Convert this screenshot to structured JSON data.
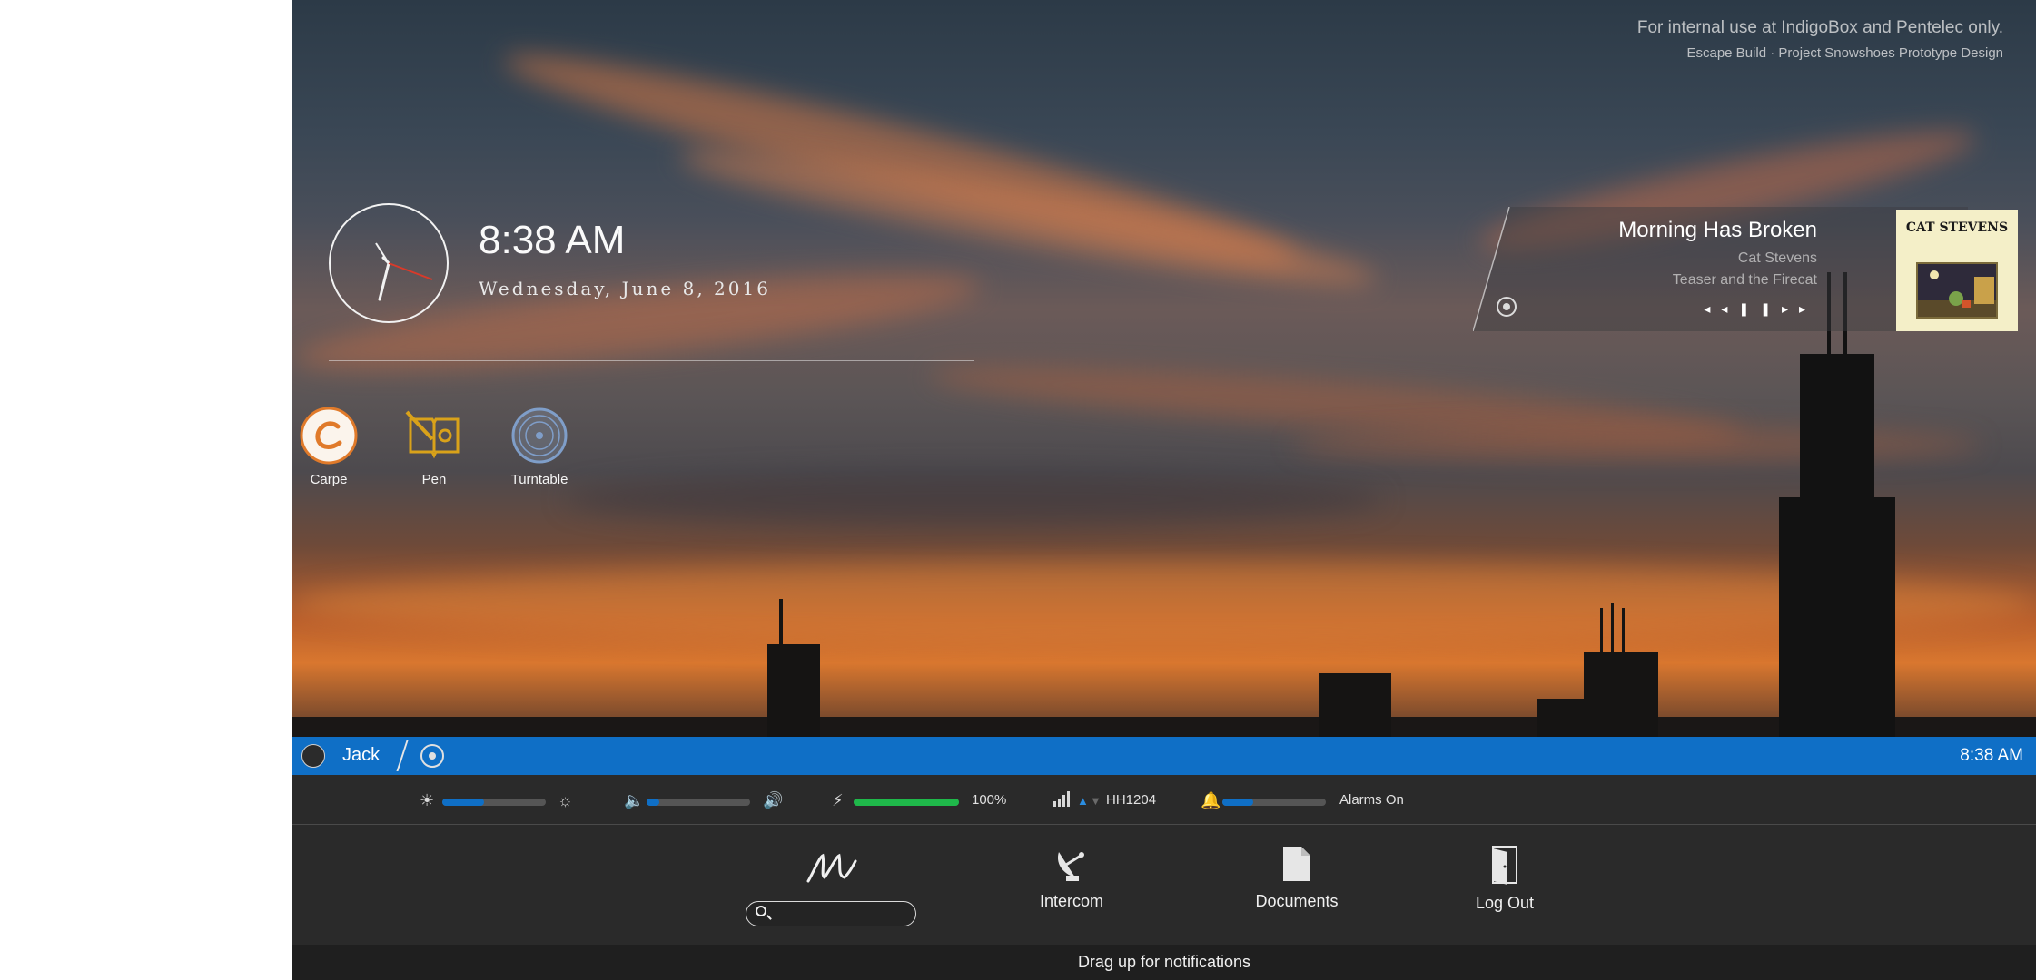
{
  "watermark": {
    "line1": "For internal use at IndigoBox and Pentelec only.",
    "line2": "Escape Build · Project Snowshoes Prototype Design"
  },
  "clock": {
    "time": "8:38 AM",
    "date": "Wednesday, June 8, 2016"
  },
  "apps": [
    {
      "label": "Carpe",
      "icon": "carpe-icon"
    },
    {
      "label": "Pen",
      "icon": "pen-icon"
    },
    {
      "label": "Turntable",
      "icon": "turntable-icon"
    }
  ],
  "now_playing": {
    "title": "Morning Has Broken",
    "artist": "Cat Stevens",
    "album": "Teaser and the Firecat",
    "album_art_text": "CAT STEVENS",
    "controls": [
      "rewind-icon",
      "pause-icon",
      "fast-forward-icon"
    ]
  },
  "user_bar": {
    "name": "Jack",
    "time": "8:38 AM",
    "color": "#0f6fc6"
  },
  "status": {
    "brightness_level": 0.4,
    "volume_level": 0.12,
    "battery_level": 1.0,
    "battery_label": "100%",
    "network_name": "HH1204",
    "alarm_level": 0.3,
    "alarm_label": "Alarms On",
    "accent_color": "#0f6fc6",
    "battery_color": "#1fb84a"
  },
  "launcher": {
    "intercom_label": "Intercom",
    "documents_label": "Documents",
    "logout_label": "Log Out",
    "search_placeholder": ""
  },
  "notifications": {
    "hint": "Drag up for notifications"
  }
}
